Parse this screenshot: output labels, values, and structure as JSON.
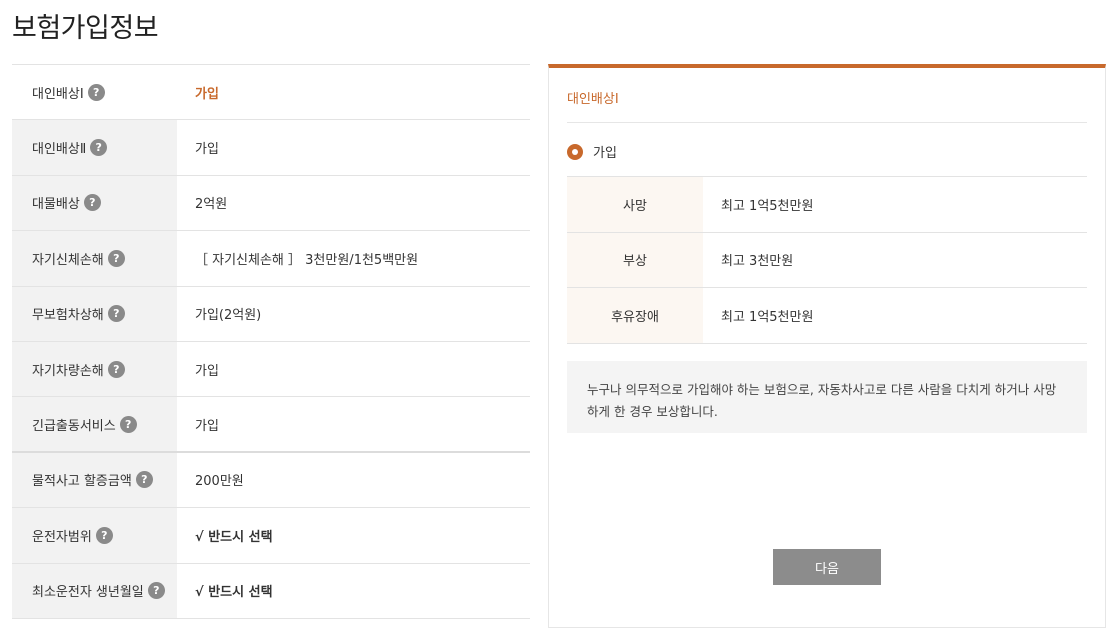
{
  "page": {
    "title": "보험가입정보"
  },
  "left_table": {
    "rows": [
      {
        "label": "대인배상Ⅰ",
        "value": "가입"
      },
      {
        "label": "대인배상Ⅱ",
        "value": "가입"
      },
      {
        "label": "대물배상",
        "value": "2억원"
      },
      {
        "label": "자기신체손해",
        "value": "［ 자기신체손해 ］ 3천만원/1천5백만원"
      },
      {
        "label": "무보험차상해",
        "value": "가입(2억원)"
      },
      {
        "label": "자기차량손해",
        "value": "가입"
      },
      {
        "label": "긴급출동서비스",
        "value": "가입"
      },
      {
        "label": "물적사고 할증금액",
        "value": "200만원"
      },
      {
        "label": "운전자범위",
        "value": "√ 반드시 선택"
      },
      {
        "label": "최소운전자 생년월일",
        "value": "√ 반드시 선택"
      }
    ],
    "help_glyph": "?"
  },
  "detail": {
    "title": "대인배상Ⅰ",
    "option_label": "가입",
    "coverage": [
      {
        "label": "사망",
        "value": "최고 1억5천만원"
      },
      {
        "label": "부상",
        "value": "최고 3천만원"
      },
      {
        "label": "후유장애",
        "value": "최고 1억5천만원"
      }
    ],
    "description": "누구나 의무적으로 가입해야 하는 보험으로, 자동차사고로 다른 사람을 다치게 하거나 사망하게 한 경우 보상합니다.",
    "next_label": "다음"
  },
  "colors": {
    "accent": "#c8692c",
    "button": "#8c8c8c"
  }
}
